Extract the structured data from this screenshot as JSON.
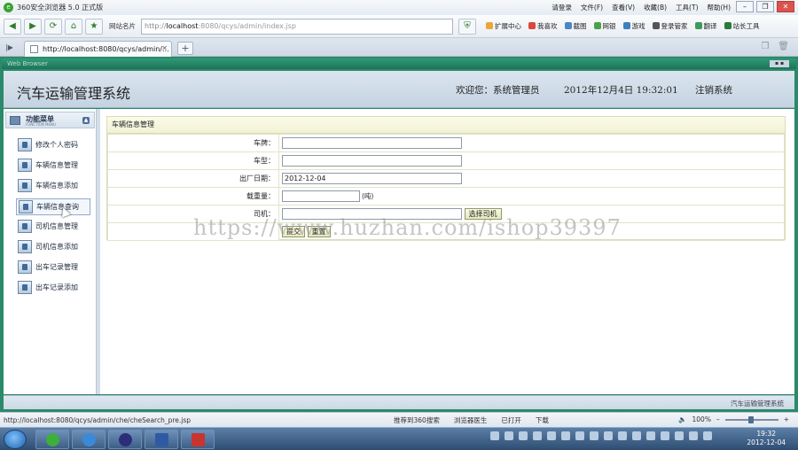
{
  "browser": {
    "title": "360安全浏览器 5.0 正式版",
    "menus": [
      "请登录",
      "文件(F)",
      "查看(V)",
      "收藏(B)",
      "工具(T)",
      "帮助(H)"
    ],
    "site_nav": "网站名片",
    "address": {
      "proto": "http://",
      "host": "localhost",
      "path": ":8080/qcys/admin/index.jsp"
    },
    "tools": [
      "扩展中心",
      "我喜欢",
      "截图",
      "网银",
      "游戏",
      "登录管家",
      "翻译",
      "站长工具"
    ],
    "tab": {
      "label": "http://localhost:8080/qcys/admin/..."
    },
    "status_url": "http://localhost:8080/qcys/admin/che/cheSearch_pre.jsp",
    "status_items": [
      "推荐到360搜索",
      "浏览器医生",
      "已打开",
      "下载"
    ],
    "zoom": "100%"
  },
  "app": {
    "frame_title": "Web Browser",
    "title": "汽车运输管理系统",
    "welcome": "欢迎您：系统管理员",
    "datetime": "2012年12月4日 19:32:01",
    "logout": "注销系统",
    "menu_head": "功能菜单",
    "menu_head_sub": "FUNCTION MENU",
    "menu": [
      "修改个人密码",
      "车辆信息管理",
      "车辆信息添加",
      "车辆信息查询",
      "司机信息管理",
      "司机信息添加",
      "出车记录管理",
      "出车记录添加"
    ],
    "active_menu_index": 3,
    "footer": "汽车运输管理系统"
  },
  "form": {
    "heading": "车辆信息管理",
    "fields": {
      "plate_label": "车牌：",
      "plate_value": "",
      "model_label": "车型：",
      "model_value": "",
      "date_label": "出厂日期：",
      "date_value": "2012-12-04",
      "load_label": "载重量：",
      "load_value": "",
      "load_unit": "(吨)",
      "driver_label": "司机：",
      "driver_value": "",
      "select_driver": "选择司机"
    },
    "submit": "提交",
    "reset": "重置"
  },
  "taskbar": {
    "clock_time": "19:32",
    "clock_date": "2012-12-04"
  },
  "watermark": "https://www.huzhan.com/ishop39397"
}
